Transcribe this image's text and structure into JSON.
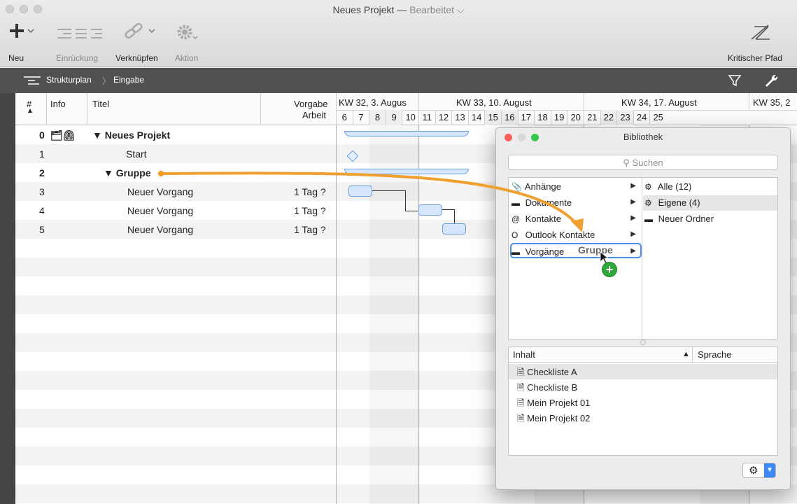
{
  "window": {
    "title": "Neues Projekt",
    "dash": "—",
    "status": "Bearbeitet"
  },
  "toolbar": {
    "new_label": "Neu",
    "indent_label": "Einrückung",
    "link_label": "Verknüpfen",
    "action_label": "Aktion",
    "critical_label": "Kritischer Pfad"
  },
  "pathbar": {
    "item1": "Strukturplan",
    "item2": "Eingabe"
  },
  "columns": {
    "num": "#",
    "info": "Info",
    "title": "Titel",
    "effort_line1": "Vorgabe",
    "effort_line2": "Arbeit"
  },
  "weeks": [
    "KW 32, 3. Augus",
    "KW 33, 10. August",
    "KW 34, 17. August",
    "KW 35, 2"
  ],
  "days": [
    "6",
    "7",
    "8",
    "9",
    "10",
    "11",
    "12",
    "13",
    "14",
    "15",
    "16",
    "17",
    "18",
    "19",
    "20",
    "21",
    "22",
    "23",
    "24",
    "25"
  ],
  "tasks": [
    {
      "num": "0",
      "info": "🗂⏲",
      "title": "▼ Neues Projekt",
      "effort": ""
    },
    {
      "num": "1",
      "info": "",
      "title": "Start",
      "effort": ""
    },
    {
      "num": "2",
      "info": "",
      "title": "▼ Gruppe",
      "effort": ""
    },
    {
      "num": "3",
      "info": "",
      "title": "Neuer Vorgang",
      "effort": "1 Tag ?"
    },
    {
      "num": "4",
      "info": "",
      "title": "Neuer Vorgang",
      "effort": "1 Tag ?"
    },
    {
      "num": "5",
      "info": "",
      "title": "Neuer Vorgang",
      "effort": "1 Tag ?"
    }
  ],
  "library": {
    "title": "Bibliothek",
    "search_placeholder": "Suchen",
    "categories": [
      "Anhänge",
      "Dokumente",
      "Kontakte",
      "Outlook Kontakte",
      "Vorgänge"
    ],
    "folders": [
      "Alle (12)",
      "Eigene (4)",
      "Neuer Ordner"
    ],
    "content_header": "Inhalt",
    "language_header": "Sprache",
    "items": [
      "Checkliste A",
      "Checkliste B",
      "Mein Projekt 01",
      "Mein Projekt 02"
    ]
  },
  "drag": {
    "label": "Gruppe",
    "badge": "+"
  },
  "colors": {
    "accent": "#3d8af7",
    "drag_arrow": "#f0a030",
    "bar_fill": "#d6e6fb",
    "bar_border": "#6d9fe0",
    "badge": "#2fa83a"
  },
  "icons": {
    "add": "plus-icon",
    "indent": "indent-icon",
    "link": "link-icon",
    "action": "gear-icon",
    "critical": "critical-path-icon",
    "filter": "filter-icon",
    "inspector": "wrench-icon"
  }
}
